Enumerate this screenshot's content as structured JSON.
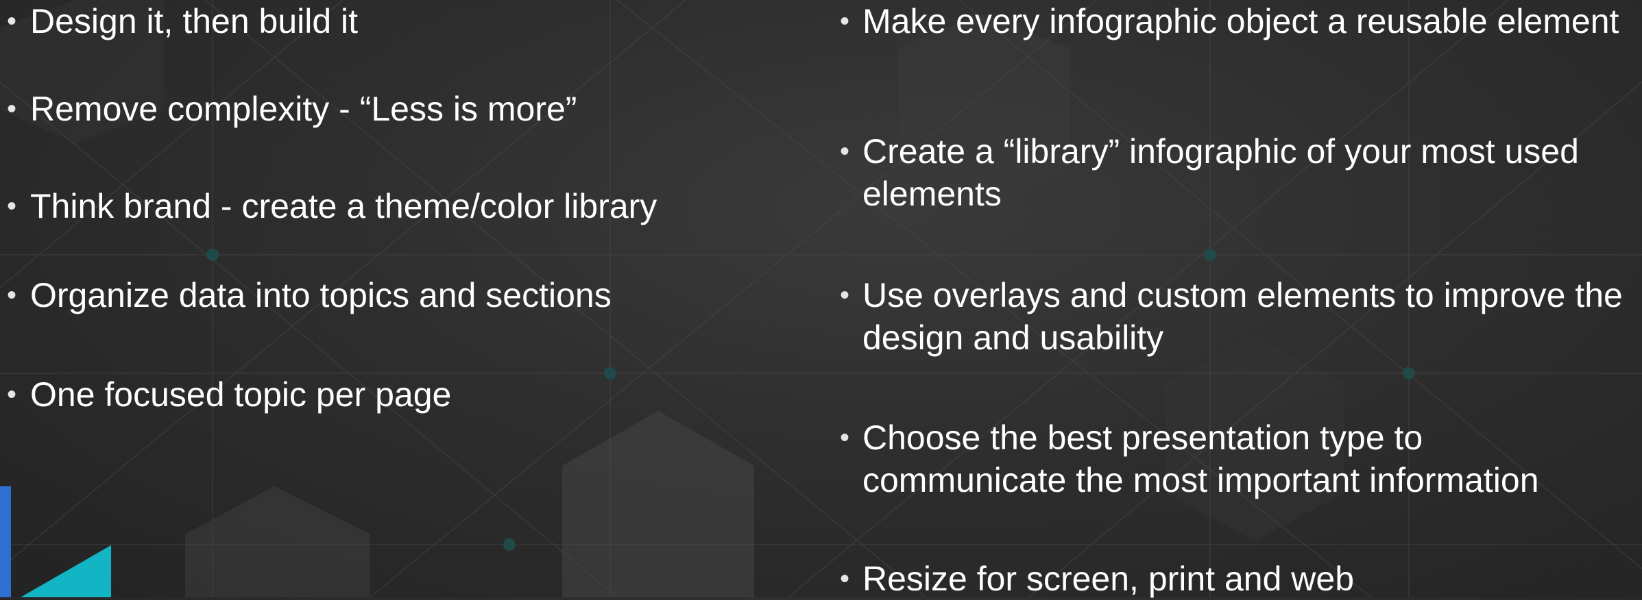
{
  "slide": {
    "left_column": [
      "Design it, then build it",
      "Remove complexity - “Less is more”",
      "Think brand - create a theme/color library",
      "Organize data into topics and sections",
      "One focused topic per page"
    ],
    "right_column": [
      "Make every infographic object a reusable element",
      "Create a “library” infographic of your most used elements",
      "Use overlays and custom elements to improve the design and usability",
      "Choose the best presentation type to communicate the most important information",
      "Resize for screen, print and web"
    ],
    "bullet_glyph": "•"
  },
  "colors": {
    "background": "#2e2e2e",
    "text": "#ffffff",
    "accent_blue": "#2e6fd0",
    "accent_teal": "#12b5c4"
  }
}
